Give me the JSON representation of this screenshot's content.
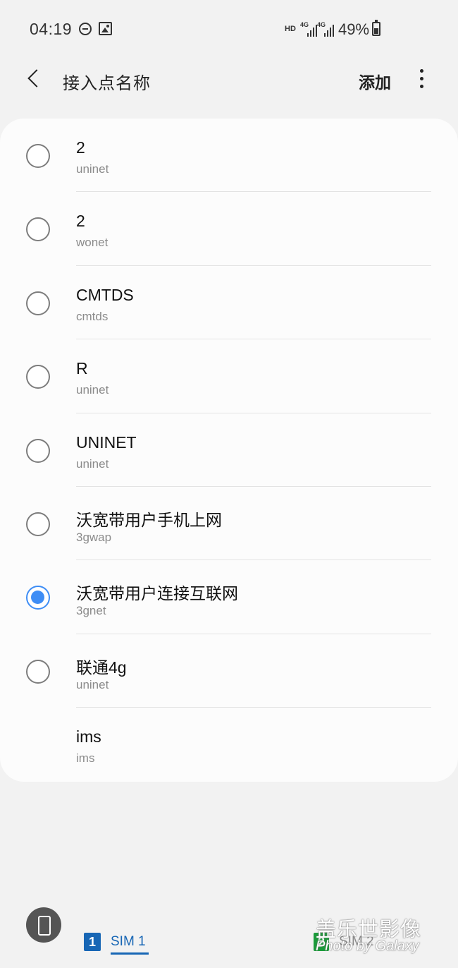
{
  "status_bar": {
    "time": "04:19",
    "icons": [
      "do-not-disturb-icon",
      "gallery-icon"
    ],
    "hd": "HD",
    "network_1": "4G",
    "network_2": "4G",
    "battery": "49%"
  },
  "app_bar": {
    "title": "接入点名称",
    "add_label": "添加",
    "back_icon": "back-arrow-icon",
    "more_icon": "more-vert-icon"
  },
  "apn_list": {
    "items": [
      {
        "name": "2",
        "apn": "uninet",
        "selected": false,
        "has_radio": true
      },
      {
        "name": "2",
        "apn": "wonet",
        "selected": false,
        "has_radio": true
      },
      {
        "name": "CMTDS",
        "apn": "cmtds",
        "selected": false,
        "has_radio": true
      },
      {
        "name": "R",
        "apn": "uninet",
        "selected": false,
        "has_radio": true
      },
      {
        "name": "UNINET",
        "apn": "uninet",
        "selected": false,
        "has_radio": true
      },
      {
        "name": "沃宽带用户手机上网",
        "apn": "3gwap",
        "selected": false,
        "has_radio": true
      },
      {
        "name": "沃宽带用户连接互联网",
        "apn": "3gnet",
        "selected": true,
        "has_radio": true
      },
      {
        "name": "联通4g",
        "apn": "uninet",
        "selected": false,
        "has_radio": true
      },
      {
        "name": "ims",
        "apn": "ims",
        "selected": false,
        "has_radio": false
      }
    ]
  },
  "sim_tabs": {
    "sim1_badge": "1",
    "sim1_label": "SIM 1",
    "sim2_badge": "2",
    "sim2_label": "SIM 2"
  },
  "watermark": {
    "line1": "盖乐世影像",
    "line2": "Photo by Galaxy"
  },
  "colors": {
    "background": "#f2f2f2",
    "card": "#fcfcfc",
    "accent": "#3e8df5",
    "sim1": "#1766b5",
    "sim2": "#1a9b3a"
  }
}
